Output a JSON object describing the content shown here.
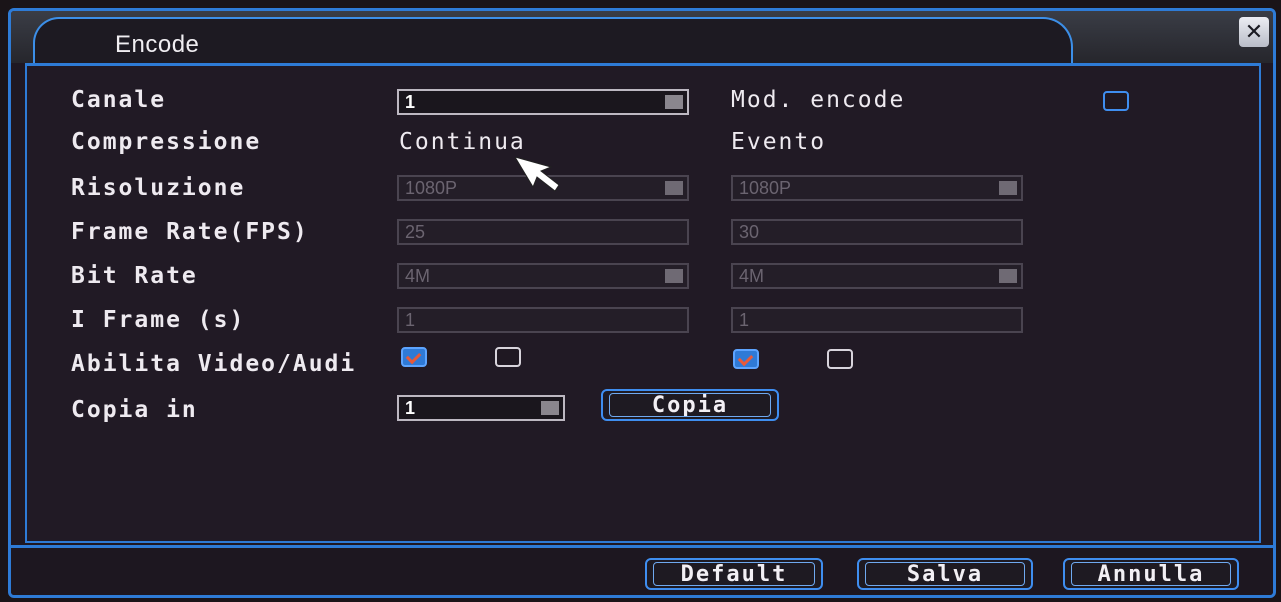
{
  "window": {
    "title": "Encode",
    "close_icon": "close-icon"
  },
  "rows": {
    "canale": {
      "label": "Canale",
      "value": "1"
    },
    "mod_encode": {
      "label": "Mod. encode"
    },
    "compressione": {
      "label": "Compressione",
      "col1": "Continua",
      "col2": "Evento"
    },
    "risoluzione": {
      "label": "Risoluzione",
      "col1": "1080P",
      "col2": "1080P"
    },
    "frame_rate": {
      "label": "Frame Rate(FPS)",
      "col1": "25",
      "col2": "30"
    },
    "bit_rate": {
      "label": "Bit Rate",
      "col1": "4M",
      "col2": "4M"
    },
    "i_frame": {
      "label": "I Frame (s)",
      "col1": "1",
      "col2": "1"
    },
    "abilita": {
      "label": "Abilita Video/Audi",
      "col1_video": true,
      "col1_audio": false,
      "col2_video": true,
      "col2_audio": false
    },
    "copia_in": {
      "label": "Copia in",
      "value": "1",
      "button": "Copia"
    }
  },
  "footer": {
    "default": "Default",
    "salva": "Salva",
    "annulla": "Annulla"
  },
  "colors": {
    "accent": "#2e7bd6",
    "background": "#1f1822",
    "text": "#eeeaf0",
    "check": "#e85a3a"
  }
}
